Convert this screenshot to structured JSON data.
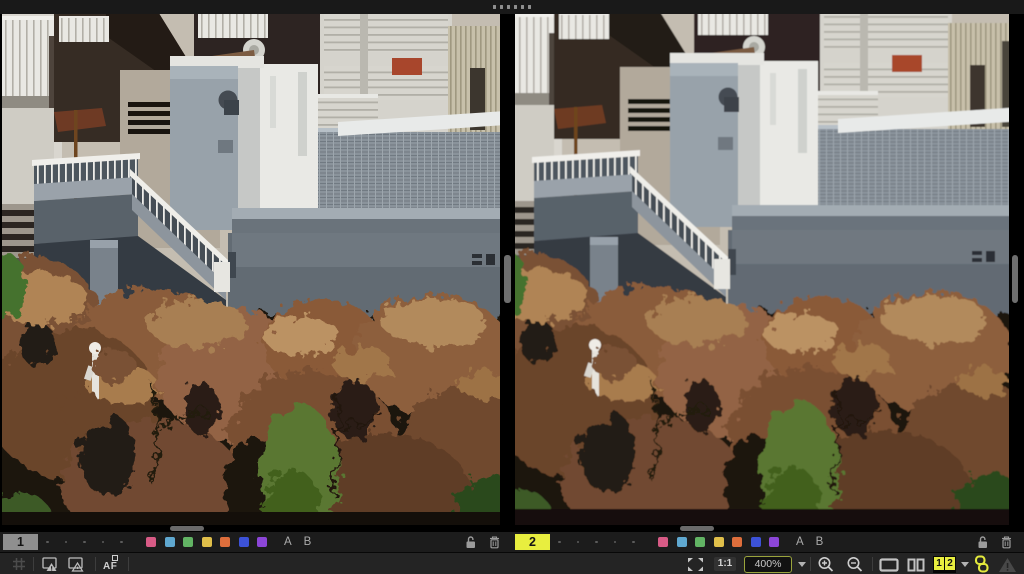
{
  "titlebar": {
    "drag_dot_count": 6
  },
  "viewer": {
    "panels": [
      {
        "badge": "1",
        "active": false,
        "rating_dot_count": 5,
        "variant_a": "A",
        "variant_b": "B"
      },
      {
        "badge": "2",
        "active": true,
        "rating_dot_count": 5,
        "variant_a": "A",
        "variant_b": "B"
      }
    ],
    "tag_colors": [
      "#d85b86",
      "#5fa8d0",
      "#62b464",
      "#e0bf4a",
      "#de6e3c",
      "#3c52d8",
      "#8c46d8"
    ],
    "filmstrip_icons": [
      "lock-icon",
      "trash-icon"
    ]
  },
  "toolbar": {
    "af_label": "AF",
    "one_to_one_label": "1:1",
    "zoom_value": "400%",
    "compare_left_label": "1",
    "compare_right_label": "2",
    "left_icons": [
      "grid-overlay-icon",
      "exposure-warning-icon",
      "focus-warning-icon",
      "af-points-icon"
    ],
    "right_icons": [
      "fit-view-icon",
      "one-to-one-icon",
      "zoom-dropdown",
      "zoom-in-icon",
      "zoom-out-icon",
      "single-view-icon",
      "multi-view-icon",
      "compare-12-icon",
      "link-panels-icon",
      "warning-icon"
    ]
  },
  "colors": {
    "accent_yellow": "#e8ee3f",
    "zoom_border_olive": "#9aa43c",
    "badge_gray": "#8f8f8f"
  }
}
